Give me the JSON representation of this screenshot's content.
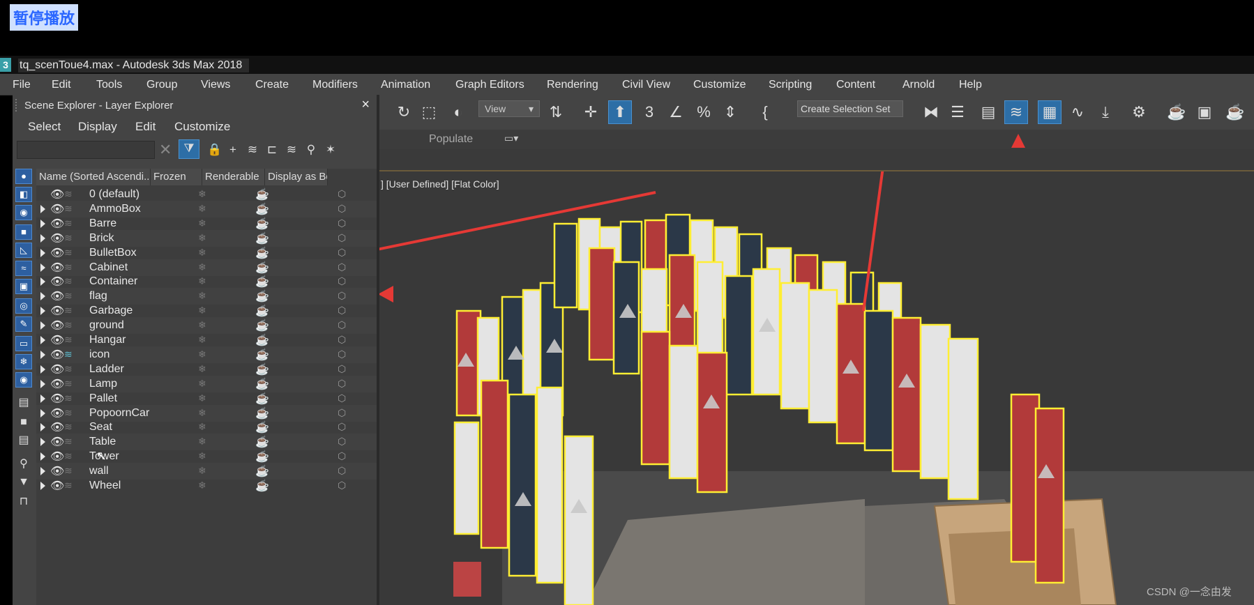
{
  "overlay": {
    "pause_label": "暂停播放"
  },
  "window": {
    "title": "tq_scenToue4.max - Autodesk 3ds Max 2018",
    "app_icon": "3"
  },
  "menubar": {
    "items": [
      "File",
      "Edit",
      "Tools",
      "Group",
      "Views",
      "Create",
      "Modifiers",
      "Animation",
      "Graph Editors",
      "Rendering",
      "Civil View",
      "Customize",
      "Scripting",
      "Content",
      "Arnold",
      "Help"
    ]
  },
  "toolbar": {
    "view_dropdown": "View",
    "selection_set": "Create Selection Set"
  },
  "ribbon": {
    "populate_label": "Populate"
  },
  "viewport": {
    "label": "] [User Defined] [Flat Color]",
    "watermark": "CSDN @一念由发"
  },
  "scene_explorer": {
    "title": "Scene Explorer - Layer Explorer",
    "close_label": "×",
    "menu": [
      "Select",
      "Display",
      "Edit",
      "Customize"
    ],
    "search": {
      "value": "",
      "placeholder": ""
    },
    "columns": [
      "Name (Sorted Ascendi...▲",
      "Frozen",
      "Renderable",
      "Display as Box"
    ],
    "layers": [
      {
        "name": "0 (default)",
        "expandable": false
      },
      {
        "name": "AmmoBox",
        "expandable": true
      },
      {
        "name": "Barre",
        "expandable": true
      },
      {
        "name": "Brick",
        "expandable": true
      },
      {
        "name": "BulletBox",
        "expandable": true
      },
      {
        "name": "Cabinet",
        "expandable": true
      },
      {
        "name": "Container",
        "expandable": true
      },
      {
        "name": "flag",
        "expandable": true
      },
      {
        "name": "Garbage",
        "expandable": true
      },
      {
        "name": "ground",
        "expandable": true
      },
      {
        "name": "Hangar",
        "expandable": true
      },
      {
        "name": "icon",
        "expandable": true,
        "current": true
      },
      {
        "name": "Ladder",
        "expandable": true
      },
      {
        "name": "Lamp",
        "expandable": true
      },
      {
        "name": "Pallet",
        "expandable": true
      },
      {
        "name": "PopoornCar",
        "expandable": true
      },
      {
        "name": "Seat",
        "expandable": true
      },
      {
        "name": "Table",
        "expandable": true
      },
      {
        "name": "Tower",
        "expandable": true
      },
      {
        "name": "wall",
        "expandable": true
      },
      {
        "name": "Wheel",
        "expandable": true
      }
    ]
  },
  "colors": {
    "accent": "#2d6ea6",
    "annotation_arrow": "#e53935",
    "selection_outline": "#ffeb3b",
    "flag_red": "#b23a3a",
    "flag_navy": "#2b3848",
    "flag_white": "#e4e4e4"
  }
}
